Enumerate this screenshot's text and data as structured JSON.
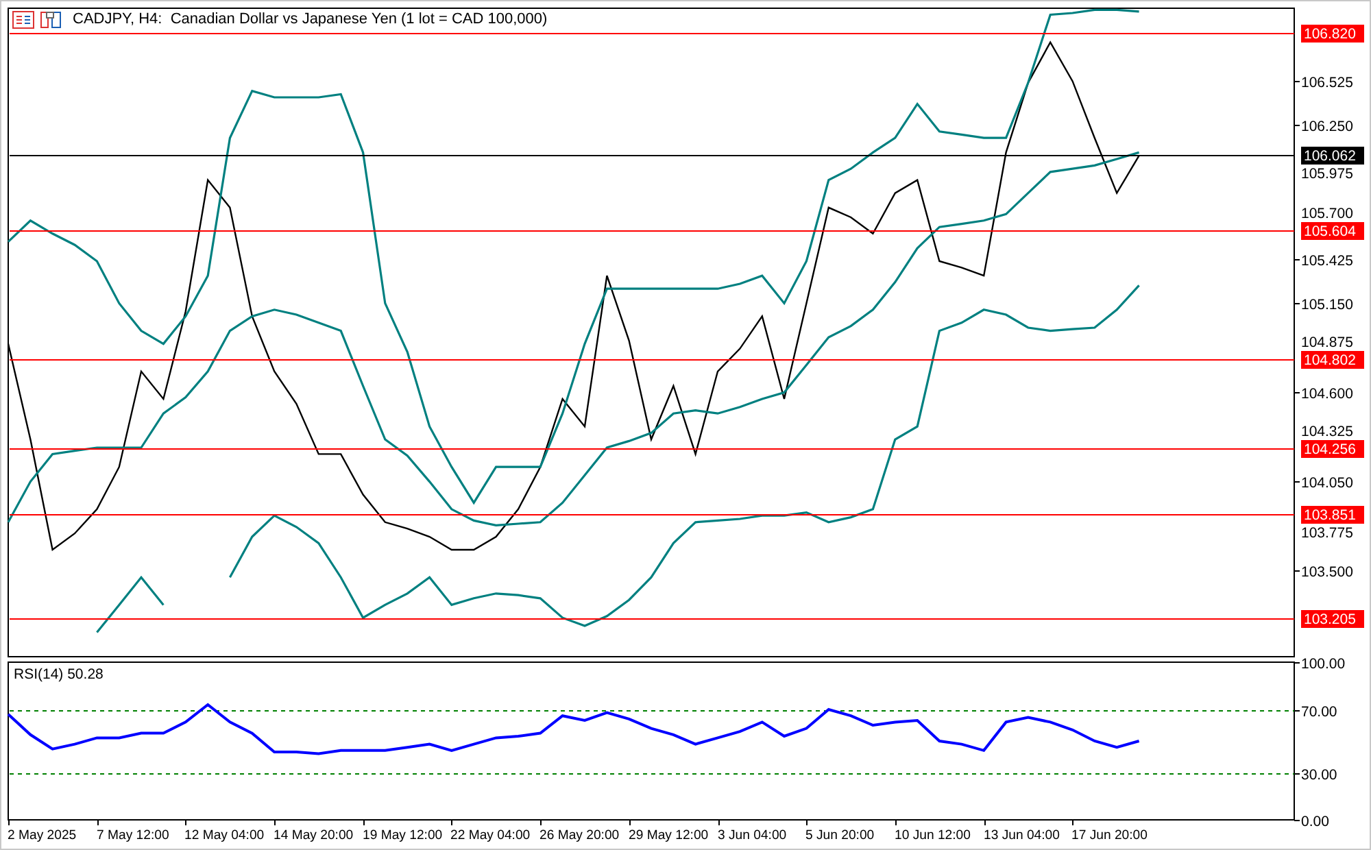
{
  "window": {
    "title": "CADJPY, H4:  Canadian Dollar vs Japanese Yen (1 lot = CAD 100,000)"
  },
  "price_pane": {
    "chart_data": {
      "type": "line",
      "categories": [
        null,
        null,
        null,
        null,
        null,
        null,
        null,
        null,
        null,
        null,
        null,
        null,
        null,
        null,
        null,
        null,
        null,
        null,
        null,
        null,
        null,
        null,
        null,
        null,
        null,
        null,
        null,
        null,
        null,
        null,
        null,
        null,
        null,
        null,
        null,
        null,
        null,
        null,
        null,
        null,
        null,
        null,
        null,
        null,
        null,
        null,
        null,
        null,
        null,
        null,
        null,
        null,
        null,
        null,
        null,
        null,
        null,
        null,
        null
      ],
      "series": [
        {
          "color": "#000000",
          "values": [
            104.9,
            104.31,
            103.63,
            103.73,
            103.88,
            104.14,
            104.73,
            104.56,
            105.1,
            105.91,
            105.74,
            105.07,
            104.73,
            104.53,
            104.22,
            104.22,
            103.97,
            103.8,
            103.76,
            103.71,
            103.63,
            103.63,
            103.71,
            103.88,
            104.14,
            104.56,
            104.39,
            105.32,
            104.92,
            104.31,
            104.64,
            104.22,
            104.73,
            104.87,
            105.07,
            104.56,
            105.15,
            105.74,
            105.68,
            105.58,
            105.83,
            105.91,
            105.41,
            105.37,
            105.32,
            106.08,
            106.51,
            106.76,
            106.52,
            106.17,
            105.83,
            106.06,
            null,
            null,
            null,
            null,
            null,
            null,
            null
          ]
        },
        {
          "color": "#008080",
          "values": [
            105.53,
            105.66,
            105.58,
            105.51,
            105.41,
            105.15,
            104.98,
            104.9,
            105.07,
            105.32,
            106.17,
            106.46,
            106.42,
            106.42,
            106.42,
            106.44,
            106.08,
            105.15,
            104.85,
            104.39,
            104.14,
            103.92,
            104.14,
            104.14,
            104.14,
            104.47,
            104.9,
            105.24,
            105.24,
            105.24,
            105.24,
            105.24,
            105.24,
            105.27,
            105.32,
            105.15,
            105.41,
            105.91,
            105.98,
            106.08,
            106.17,
            106.38,
            106.21,
            106.19,
            106.17,
            106.17,
            106.51,
            106.93,
            106.94,
            106.96,
            106.96,
            106.95,
            null,
            null,
            null,
            null,
            null,
            null,
            null
          ]
        },
        {
          "color": "#008080",
          "values": [
            103.8,
            104.05,
            104.22,
            104.24,
            104.26,
            104.26,
            104.26,
            104.47,
            104.57,
            104.73,
            104.98,
            105.07,
            105.11,
            105.08,
            105.03,
            104.98,
            104.64,
            104.31,
            104.21,
            104.05,
            103.88,
            103.81,
            103.78,
            103.79,
            103.8,
            103.92,
            104.09,
            104.26,
            104.3,
            104.35,
            104.47,
            104.49,
            104.47,
            104.51,
            104.56,
            104.6,
            104.77,
            104.94,
            105.01,
            105.11,
            105.28,
            105.49,
            105.62,
            105.64,
            105.66,
            105.7,
            105.83,
            105.96,
            105.98,
            106.0,
            106.04,
            106.08,
            null,
            null,
            null,
            null,
            null,
            null,
            null
          ]
        },
        {
          "color": "#008080",
          "values": [
            null,
            null,
            null,
            null,
            103.12,
            103.29,
            103.46,
            103.29,
            null,
            null,
            103.46,
            103.71,
            103.84,
            103.77,
            103.67,
            103.46,
            103.21,
            103.29,
            103.36,
            103.46,
            103.29,
            103.33,
            103.36,
            103.35,
            103.33,
            103.21,
            103.16,
            103.22,
            103.32,
            103.46,
            103.67,
            103.8,
            103.81,
            103.82,
            103.84,
            103.84,
            103.86,
            103.8,
            103.83,
            103.88,
            104.31,
            104.39,
            104.98,
            105.03,
            105.11,
            105.08,
            105.0,
            104.98,
            104.99,
            105.0,
            105.11,
            105.26,
            null,
            null,
            null,
            null,
            null,
            null,
            null
          ]
        },
        {
          "name": "106.820",
          "color": "#ff0000",
          "values": [
            106.82,
            106.82,
            106.82,
            106.82,
            106.82,
            106.82,
            106.82,
            106.82,
            106.82,
            106.82,
            106.82,
            106.82,
            106.82,
            106.82,
            106.82,
            106.82,
            106.82,
            106.82,
            106.82,
            106.82,
            106.82,
            106.82,
            106.82,
            106.82,
            106.82,
            106.82,
            106.82,
            106.82,
            106.82,
            106.82,
            106.82,
            106.82,
            106.82,
            106.82,
            106.82,
            106.82,
            106.82,
            106.82,
            106.82,
            106.82,
            106.82,
            106.82,
            106.82,
            106.82,
            106.82,
            106.82,
            106.82,
            106.82,
            106.82,
            106.82,
            106.82,
            106.82,
            106.82,
            106.82,
            106.82,
            106.82,
            106.82,
            106.82,
            106.82
          ]
        },
        {
          "name": "105.604",
          "color": "#ff0000",
          "values": [
            105.604,
            105.604,
            105.604,
            105.604,
            105.604,
            105.604,
            105.604,
            105.604,
            105.604,
            105.604,
            105.604,
            105.604,
            105.604,
            105.604,
            105.604,
            105.604,
            105.604,
            105.604,
            105.604,
            105.604,
            105.604,
            105.604,
            105.604,
            105.604,
            105.604,
            105.604,
            105.604,
            105.604,
            105.604,
            105.604,
            105.604,
            105.604,
            105.604,
            105.604,
            105.604,
            105.604,
            105.604,
            105.604,
            105.604,
            105.604,
            105.604,
            105.604,
            105.604,
            105.604,
            105.604,
            105.604,
            105.604,
            105.604,
            105.604,
            105.604,
            105.604,
            105.604,
            105.604,
            105.604,
            105.604,
            105.604,
            105.604,
            105.604,
            105.604
          ]
        },
        {
          "name": "104.802",
          "color": "#ff0000",
          "values": [
            104.802,
            104.802,
            104.802,
            104.802,
            104.802,
            104.802,
            104.802,
            104.802,
            104.802,
            104.802,
            104.802,
            104.802,
            104.802,
            104.802,
            104.802,
            104.802,
            104.802,
            104.802,
            104.802,
            104.802,
            104.802,
            104.802,
            104.802,
            104.802,
            104.802,
            104.802,
            104.802,
            104.802,
            104.802,
            104.802,
            104.802,
            104.802,
            104.802,
            104.802,
            104.802,
            104.802,
            104.802,
            104.802,
            104.802,
            104.802,
            104.802,
            104.802,
            104.802,
            104.802,
            104.802,
            104.802,
            104.802,
            104.802,
            104.802,
            104.802,
            104.802,
            104.802,
            104.802,
            104.802,
            104.802,
            104.802,
            104.802,
            104.802,
            104.802
          ]
        },
        {
          "name": "104.256",
          "color": "#ff0000",
          "values": [
            104.256,
            104.256,
            104.256,
            104.256,
            104.256,
            104.256,
            104.256,
            104.256,
            104.256,
            104.256,
            104.256,
            104.256,
            104.256,
            104.256,
            104.256,
            104.256,
            104.256,
            104.256,
            104.256,
            104.256,
            104.256,
            104.256,
            104.256,
            104.256,
            104.256,
            104.256,
            104.256,
            104.256,
            104.256,
            104.256,
            104.256,
            104.256,
            104.256,
            104.256,
            104.256,
            104.256,
            104.256,
            104.256,
            104.256,
            104.256,
            104.256,
            104.256,
            104.256,
            104.256,
            104.256,
            104.256,
            104.256,
            104.256,
            104.256,
            104.256,
            104.256,
            104.256,
            104.256,
            104.256,
            104.256,
            104.256,
            104.256,
            104.256,
            104.256
          ]
        },
        {
          "name": "103.851",
          "color": "#ff0000",
          "values": [
            103.851,
            103.851,
            103.851,
            103.851,
            103.851,
            103.851,
            103.851,
            103.851,
            103.851,
            103.851,
            103.851,
            103.851,
            103.851,
            103.851,
            103.851,
            103.851,
            103.851,
            103.851,
            103.851,
            103.851,
            103.851,
            103.851,
            103.851,
            103.851,
            103.851,
            103.851,
            103.851,
            103.851,
            103.851,
            103.851,
            103.851,
            103.851,
            103.851,
            103.851,
            103.851,
            103.851,
            103.851,
            103.851,
            103.851,
            103.851,
            103.851,
            103.851,
            103.851,
            103.851,
            103.851,
            103.851,
            103.851,
            103.851,
            103.851,
            103.851,
            103.851,
            103.851,
            103.851,
            103.851,
            103.851,
            103.851,
            103.851,
            103.851,
            103.851
          ]
        },
        {
          "name": "103.205",
          "color": "#ff0000",
          "values": [
            103.205,
            103.205,
            103.205,
            103.205,
            103.205,
            103.205,
            103.205,
            103.205,
            103.205,
            103.205,
            103.205,
            103.205,
            103.205,
            103.205,
            103.205,
            103.205,
            103.205,
            103.205,
            103.205,
            103.205,
            103.205,
            103.205,
            103.205,
            103.205,
            103.205,
            103.205,
            103.205,
            103.205,
            103.205,
            103.205,
            103.205,
            103.205,
            103.205,
            103.205,
            103.205,
            103.205,
            103.205,
            103.205,
            103.205,
            103.205,
            103.205,
            103.205,
            103.205,
            103.205,
            103.205,
            103.205,
            103.205,
            103.205,
            103.205,
            103.205,
            103.205,
            103.205,
            103.205,
            103.205,
            103.205,
            103.205,
            103.205,
            103.205,
            103.205
          ]
        },
        {
          "name": "106.062",
          "color": "#000000",
          "values": [
            106.062,
            106.062,
            106.062,
            106.062,
            106.062,
            106.062,
            106.062,
            106.062,
            106.062,
            106.062,
            106.062,
            106.062,
            106.062,
            106.062,
            106.062,
            106.062,
            106.062,
            106.062,
            106.062,
            106.062,
            106.062,
            106.062,
            106.062,
            106.062,
            106.062,
            106.062,
            106.062,
            106.062,
            106.062,
            106.062,
            106.062,
            106.062,
            106.062,
            106.062,
            106.062,
            106.062,
            106.062,
            106.062,
            106.062,
            106.062,
            106.062,
            106.062,
            106.062,
            106.062,
            106.062,
            106.062,
            106.062,
            106.062,
            106.062,
            106.062,
            106.062,
            106.062,
            106.062,
            106.062,
            106.062,
            106.062,
            106.062,
            106.062,
            106.062
          ]
        }
      ],
      "legend": "right",
      "ylim": [
        102.97,
        106.97
      ],
      "yticks": [
        {
          "value": 106.525,
          "label": "106.525"
        },
        {
          "value": 106.25,
          "label": "106.250"
        },
        {
          "value": 105.975,
          "label": "105.975"
        },
        {
          "value": 105.7,
          "label": "105.700"
        },
        {
          "value": 105.425,
          "label": "105.425"
        },
        {
          "value": 105.15,
          "label": "105.150"
        },
        {
          "value": 104.875,
          "label": "104.875"
        },
        {
          "value": 104.6,
          "label": "104.600"
        },
        {
          "value": 104.325,
          "label": "104.325"
        },
        {
          "value": 104.05,
          "label": "104.050"
        },
        {
          "value": 103.775,
          "label": "103.775"
        },
        {
          "value": 103.5,
          "label": "103.500"
        }
      ]
    }
  },
  "rsi_pane": {
    "label": "RSI(14) 50.28",
    "time_axis": [
      "2 May 2025",
      "7 May 12:00",
      "12 May 04:00",
      "14 May 20:00",
      "19 May 12:00",
      "22 May 04:00",
      "26 May 20:00",
      "29 May 12:00",
      "3 Jun 04:00",
      "5 Jun 20:00",
      "10 Jun 12:00",
      "13 Jun 04:00",
      "17 Jun 20:00"
    ],
    "chart_data": {
      "type": "line",
      "categories": [
        null,
        null,
        null,
        null,
        null,
        null,
        null,
        null,
        null,
        null,
        null,
        null,
        null,
        null,
        null,
        null,
        null,
        null,
        null,
        null,
        null,
        null,
        null,
        null,
        null,
        null,
        null,
        null,
        null,
        null,
        null,
        null,
        null,
        null,
        null,
        null,
        null,
        null,
        null,
        null,
        null,
        null,
        null,
        null,
        null,
        null,
        null,
        null,
        null,
        null,
        null,
        null,
        null,
        null,
        null,
        null,
        null,
        null,
        null
      ],
      "series": [
        {
          "color": "#0000ff",
          "values": [
            67,
            54,
            45,
            48,
            52,
            52,
            55,
            55,
            62,
            73,
            62,
            55,
            43,
            43,
            42,
            44,
            44,
            44,
            46,
            48,
            44,
            48,
            52,
            53,
            55,
            66,
            63,
            68,
            64,
            58,
            54,
            48,
            52,
            56,
            62,
            53,
            58,
            70,
            66,
            60,
            62,
            63,
            50,
            48,
            44,
            62,
            65,
            62,
            57,
            50,
            46,
            50,
            null,
            null,
            null,
            null,
            null,
            null,
            null
          ]
        }
      ],
      "ylim": [
        0,
        100
      ],
      "yticks": [
        {
          "value": 100,
          "label": "100.00"
        },
        {
          "value": 70,
          "label": "70.00"
        },
        {
          "value": 30,
          "label": "30.00"
        },
        {
          "value": 0,
          "label": "0.00"
        }
      ]
    }
  }
}
